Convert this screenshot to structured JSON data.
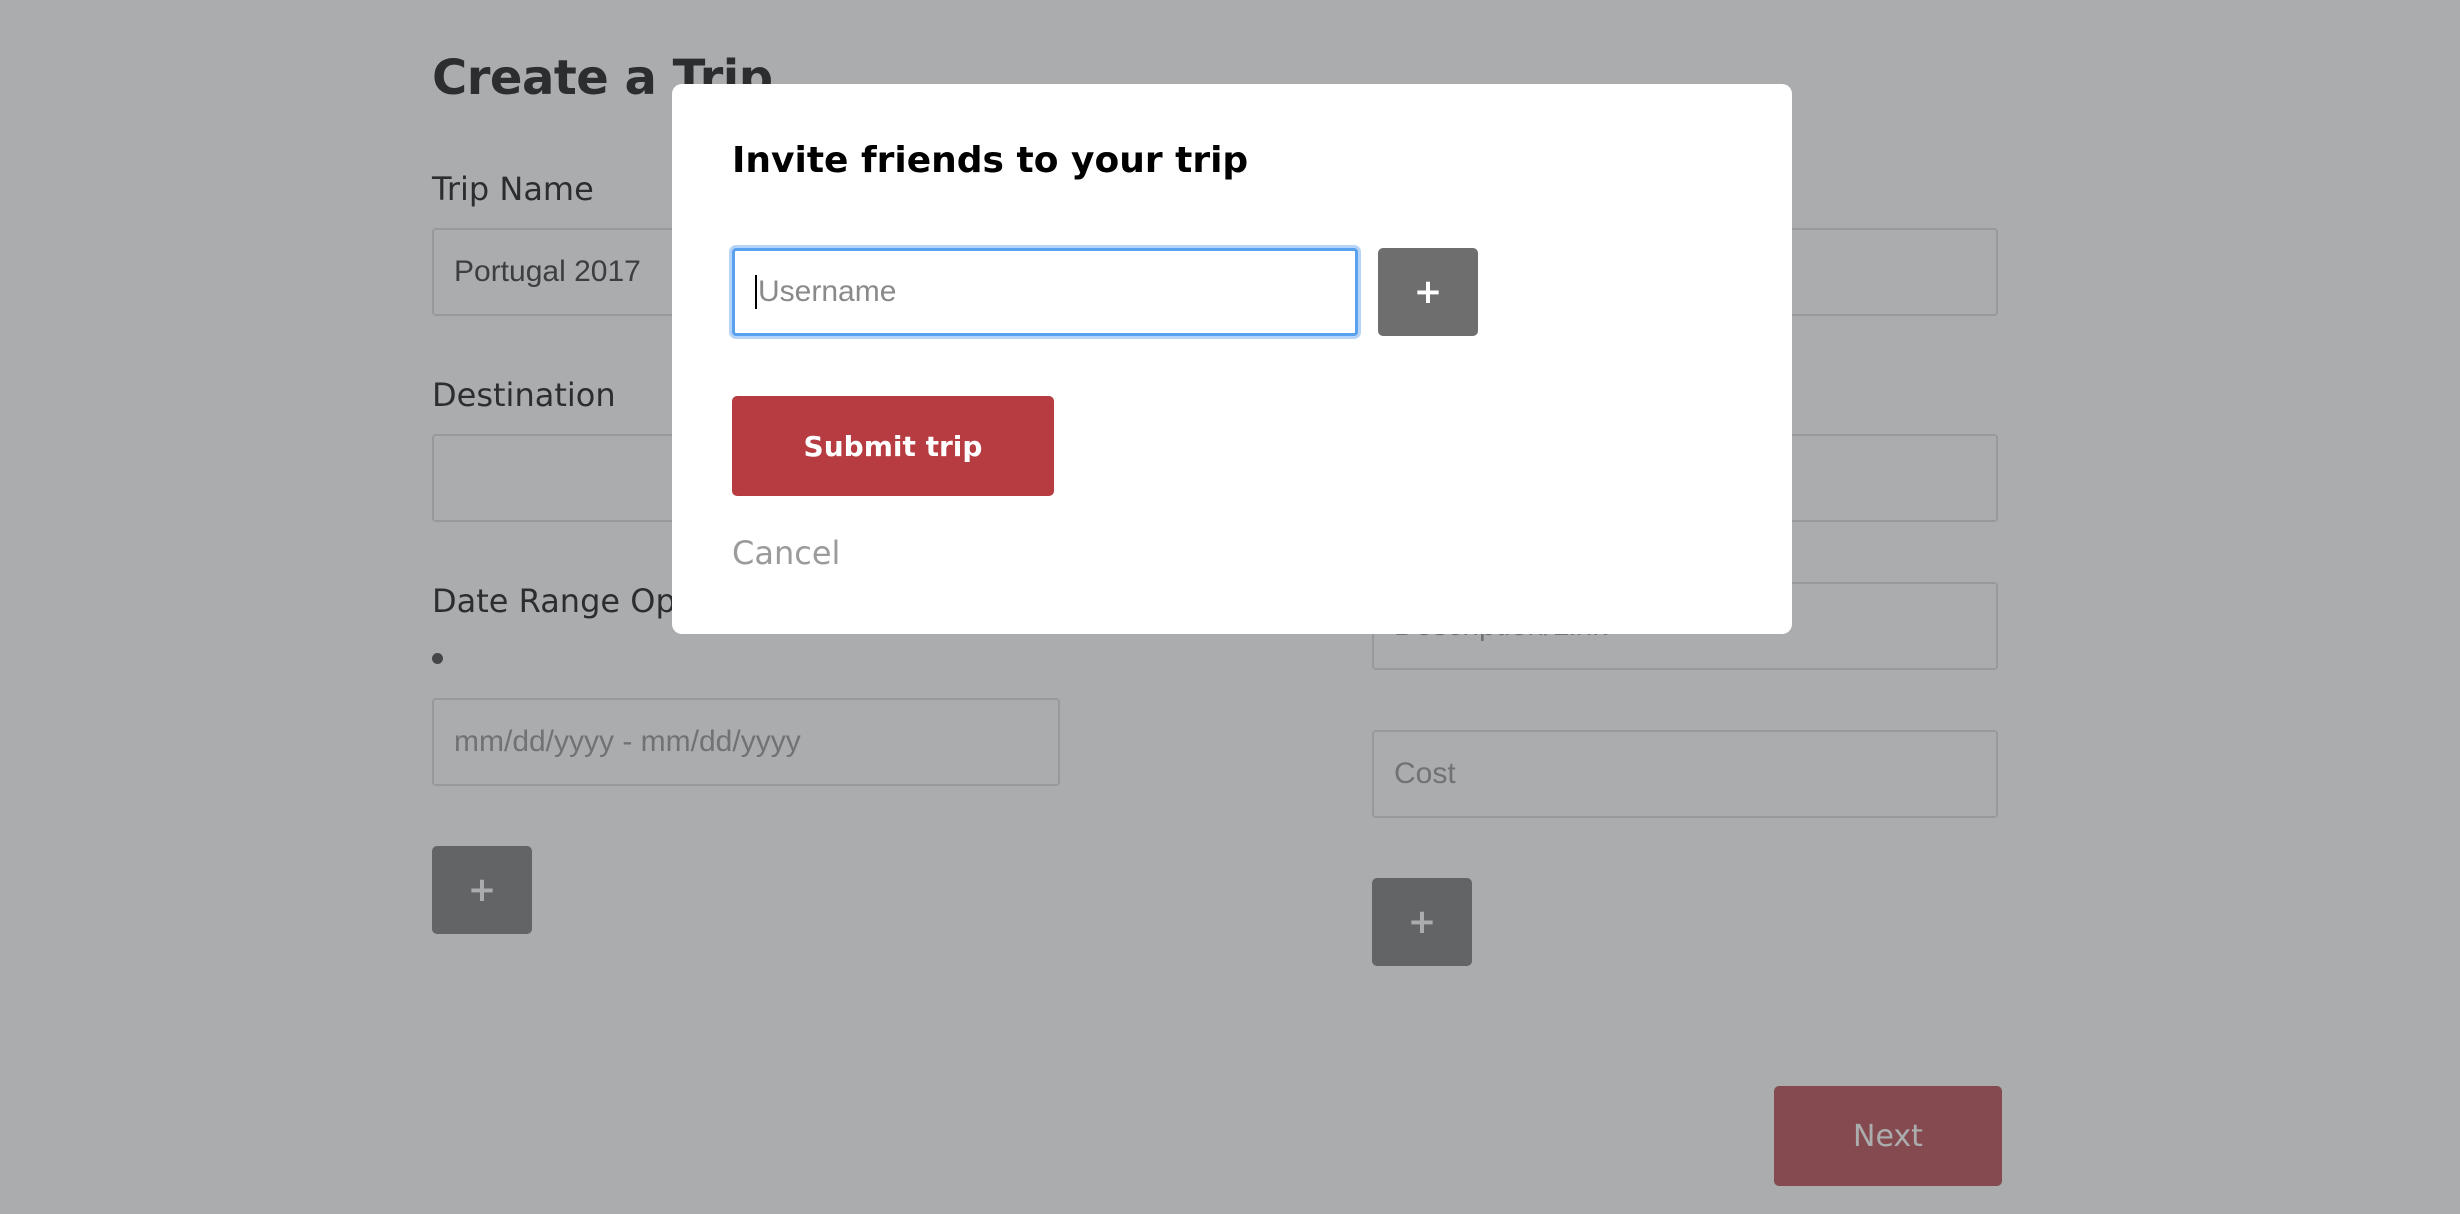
{
  "page": {
    "title": "Create a Trip",
    "trip_name": {
      "label": "Trip Name",
      "value": "Portugal 2017"
    },
    "destination": {
      "label": "Destination",
      "value": ""
    },
    "date_range": {
      "label": "Date Range Options",
      "placeholder": "mm/dd/yyyy - mm/dd/yyyy",
      "add_label": "+"
    },
    "right_column": {
      "field1_value": "",
      "field2_value": "",
      "description_placeholder": "Description/Link",
      "cost_placeholder": "Cost",
      "add_label": "+"
    },
    "next_label": "Next"
  },
  "modal": {
    "title": "Invite friends to your trip",
    "username_placeholder": "Username",
    "add_label": "+",
    "submit_label": "Submit trip",
    "cancel_label": "Cancel"
  },
  "colors": {
    "overlay": "#585a5d",
    "accent_red": "#b63c41",
    "button_gray": "#6e6e6e",
    "focus_blue": "#5aa2f0",
    "cancel_gray": "#9b9b9b"
  }
}
